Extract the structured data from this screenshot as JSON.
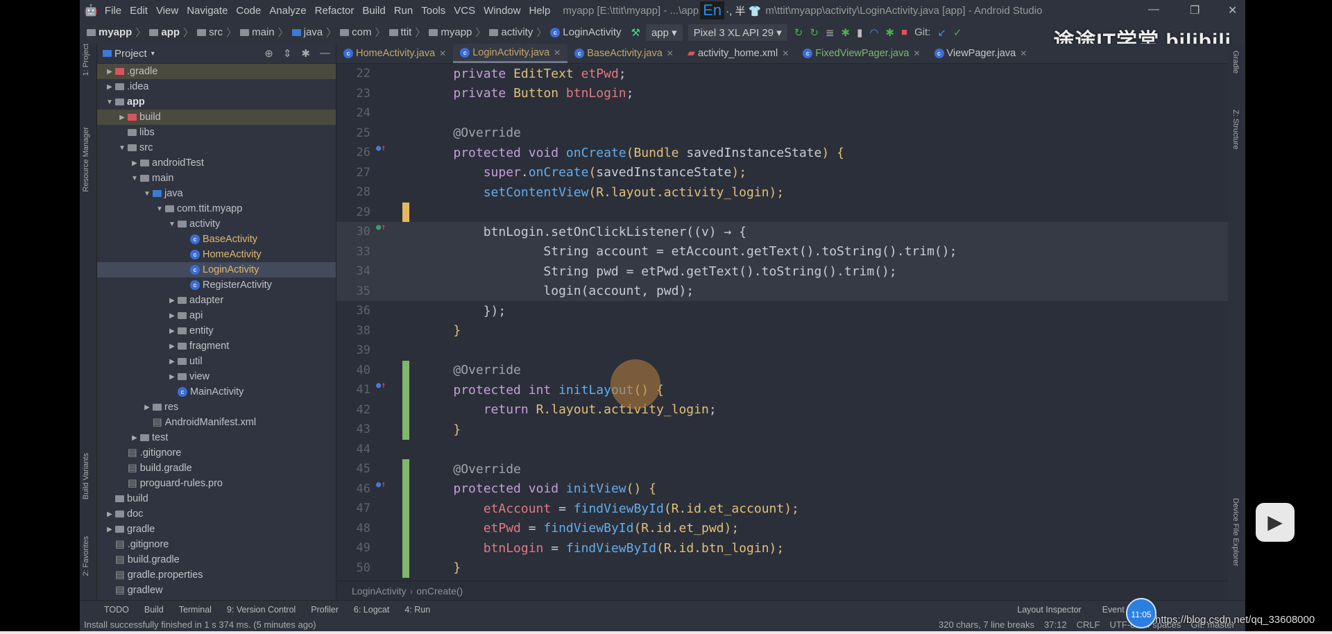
{
  "window": {
    "title": "myapp [E:\\ttit\\myapp] - ...\\app",
    "title_rest": "m\\ttit\\myapp\\activity\\LoginActivity.java [app] - Android Studio",
    "ime": "En",
    "ime_extra": "·, 半 👕",
    "minimize": "—",
    "restore": "❐",
    "close": "✕"
  },
  "menu": [
    "File",
    "Edit",
    "View",
    "Navigate",
    "Code",
    "Analyze",
    "Refactor",
    "Build",
    "Run",
    "Tools",
    "VCS",
    "Window",
    "Help"
  ],
  "breadcrumb": [
    {
      "label": "myapp",
      "bold": true,
      "icon": "module-folder"
    },
    {
      "label": "app",
      "bold": true,
      "icon": "module-folder"
    },
    {
      "label": "src",
      "icon": "folder"
    },
    {
      "label": "main",
      "icon": "folder"
    },
    {
      "label": "java",
      "icon": "source-folder"
    },
    {
      "label": "com",
      "icon": "package"
    },
    {
      "label": "ttit",
      "icon": "package"
    },
    {
      "label": "myapp",
      "icon": "package"
    },
    {
      "label": "activity",
      "icon": "package"
    },
    {
      "label": "LoginActivity",
      "icon": "class"
    }
  ],
  "toolbar": {
    "run_config": "app",
    "device": "Pixel 3 XL API 29",
    "git_label": "Git:"
  },
  "watermark": "途途IT学堂 bilibili",
  "left_strip": {
    "project": "1: Project",
    "resource_manager": "Resource Manager",
    "build_variants": "Build Variants",
    "favorites": "2: Favorites"
  },
  "right_strip": {
    "gradle": "Gradle",
    "structure": "Z: Structure",
    "device_explorer": "Device File Explorer"
  },
  "project_panel": {
    "title": "Project",
    "items": [
      {
        "label": ".gradle",
        "depth": 0,
        "arrow": "right",
        "icon": "red",
        "hl": true
      },
      {
        "label": ".idea",
        "depth": 0,
        "arrow": "right",
        "icon": "folder"
      },
      {
        "label": "app",
        "depth": 0,
        "arrow": "down",
        "icon": "folder",
        "bold": true
      },
      {
        "label": "build",
        "depth": 1,
        "arrow": "right",
        "icon": "red",
        "hl": true
      },
      {
        "label": "libs",
        "depth": 1,
        "arrow": "",
        "icon": "folder"
      },
      {
        "label": "src",
        "depth": 1,
        "arrow": "down",
        "icon": "folder"
      },
      {
        "label": "androidTest",
        "depth": 2,
        "arrow": "right",
        "icon": "folder"
      },
      {
        "label": "main",
        "depth": 2,
        "arrow": "down",
        "icon": "folder"
      },
      {
        "label": "java",
        "depth": 3,
        "arrow": "down",
        "icon": "blue"
      },
      {
        "label": "com.ttit.myapp",
        "depth": 4,
        "arrow": "down",
        "icon": "folder"
      },
      {
        "label": "activity",
        "depth": 5,
        "arrow": "down",
        "icon": "folder"
      },
      {
        "label": "BaseActivity",
        "depth": 6,
        "arrow": "",
        "icon": "class",
        "java": true
      },
      {
        "label": "HomeActivity",
        "depth": 6,
        "arrow": "",
        "icon": "class",
        "java": true
      },
      {
        "label": "LoginActivity",
        "depth": 6,
        "arrow": "",
        "icon": "class",
        "java": true,
        "sel": true
      },
      {
        "label": "RegisterActivity",
        "depth": 6,
        "arrow": "",
        "icon": "class"
      },
      {
        "label": "adapter",
        "depth": 5,
        "arrow": "right",
        "icon": "folder"
      },
      {
        "label": "api",
        "depth": 5,
        "arrow": "right",
        "icon": "folder"
      },
      {
        "label": "entity",
        "depth": 5,
        "arrow": "right",
        "icon": "folder"
      },
      {
        "label": "fragment",
        "depth": 5,
        "arrow": "right",
        "icon": "folder"
      },
      {
        "label": "util",
        "depth": 5,
        "arrow": "right",
        "icon": "folder"
      },
      {
        "label": "view",
        "depth": 5,
        "arrow": "right",
        "icon": "folder"
      },
      {
        "label": "MainActivity",
        "depth": 5,
        "arrow": "",
        "icon": "class"
      },
      {
        "label": "res",
        "depth": 3,
        "arrow": "right",
        "icon": "folder"
      },
      {
        "label": "AndroidManifest.xml",
        "depth": 3,
        "arrow": "",
        "icon": "file"
      },
      {
        "label": "test",
        "depth": 2,
        "arrow": "right",
        "icon": "folder"
      },
      {
        "label": ".gitignore",
        "depth": 1,
        "arrow": "",
        "icon": "file"
      },
      {
        "label": "build.gradle",
        "depth": 1,
        "arrow": "",
        "icon": "file"
      },
      {
        "label": "proguard-rules.pro",
        "depth": 1,
        "arrow": "",
        "icon": "file"
      },
      {
        "label": "build",
        "depth": 0,
        "arrow": "",
        "icon": "folder"
      },
      {
        "label": "doc",
        "depth": 0,
        "arrow": "right",
        "icon": "folder"
      },
      {
        "label": "gradle",
        "depth": 0,
        "arrow": "right",
        "icon": "folder"
      },
      {
        "label": ".gitignore",
        "depth": 0,
        "arrow": "",
        "icon": "file"
      },
      {
        "label": "build.gradle",
        "depth": 0,
        "arrow": "",
        "icon": "file"
      },
      {
        "label": "gradle.properties",
        "depth": 0,
        "arrow": "",
        "icon": "file"
      },
      {
        "label": "gradlew",
        "depth": 0,
        "arrow": "",
        "icon": "file"
      }
    ]
  },
  "tabs": [
    {
      "label": "HomeActivity.java",
      "style": "java"
    },
    {
      "label": "LoginActivity.java",
      "style": "java",
      "active": true
    },
    {
      "label": "BaseActivity.java",
      "style": "java"
    },
    {
      "label": "activity_home.xml",
      "style": "xml"
    },
    {
      "label": "FixedViewPager.java",
      "style": "green"
    },
    {
      "label": "ViewPager.java",
      "style": "plain"
    }
  ],
  "code": [
    {
      "n": "22",
      "t": [
        [
          "    ",
          "s"
        ],
        [
          "private ",
          "k"
        ],
        [
          "EditText ",
          "t"
        ],
        [
          "etPwd",
          "f"
        ],
        [
          ";",
          "s"
        ]
      ]
    },
    {
      "n": "23",
      "t": [
        [
          "    ",
          "s"
        ],
        [
          "private ",
          "k"
        ],
        [
          "Button ",
          "t"
        ],
        [
          "btnLogin",
          "f"
        ],
        [
          ";",
          "s"
        ]
      ]
    },
    {
      "n": "24",
      "t": []
    },
    {
      "n": "25",
      "t": [
        [
          "    ",
          "s"
        ],
        [
          "@Override",
          "a"
        ]
      ]
    },
    {
      "n": "26",
      "mark": "o",
      "t": [
        [
          "    ",
          "s"
        ],
        [
          "protected ",
          "k"
        ],
        [
          "void ",
          "k"
        ],
        [
          "onCreate",
          "m"
        ],
        [
          "(",
          "p"
        ],
        [
          "Bundle ",
          "t"
        ],
        [
          "savedInstanceState",
          "s"
        ],
        [
          ") {",
          "p"
        ]
      ]
    },
    {
      "n": "27",
      "t": [
        [
          "        ",
          "s"
        ],
        [
          "super",
          "k"
        ],
        [
          ".",
          "s"
        ],
        [
          "onCreate",
          "m"
        ],
        [
          "(",
          "p"
        ],
        [
          "savedInstanceState",
          "s"
        ],
        [
          ");",
          "p"
        ]
      ]
    },
    {
      "n": "28",
      "t": [
        [
          "        ",
          "s"
        ],
        [
          "setContentView",
          "m"
        ],
        [
          "(",
          "p"
        ],
        [
          "R.layout.activity_login",
          "t"
        ],
        [
          ");",
          "p"
        ]
      ]
    },
    {
      "n": "29",
      "change": "#e5b860",
      "t": []
    },
    {
      "n": "30",
      "mark": "I",
      "lam": true,
      "t": [
        [
          "        btnLogin.setOnClickListener((v) → {",
          "s"
        ]
      ]
    },
    {
      "n": "33",
      "lam": true,
      "t": [
        [
          "                String account = etAccount.getText().toString().trim();",
          "s"
        ]
      ]
    },
    {
      "n": "34",
      "lam": true,
      "t": [
        [
          "                String pwd = etPwd.getText().toString().trim();",
          "s"
        ]
      ]
    },
    {
      "n": "35",
      "lam": true,
      "t": [
        [
          "                login(account, pwd);",
          "s"
        ]
      ]
    },
    {
      "n": "36",
      "t": [
        [
          "        });",
          "s"
        ]
      ]
    },
    {
      "n": "38",
      "t": [
        [
          "    }",
          "p"
        ]
      ]
    },
    {
      "n": "39",
      "t": []
    },
    {
      "n": "40",
      "change": "#7fb86a",
      "t": [
        [
          "    ",
          "s"
        ],
        [
          "@Override",
          "a"
        ]
      ]
    },
    {
      "n": "41",
      "mark": "o",
      "change": "#7fb86a",
      "t": [
        [
          "    ",
          "s"
        ],
        [
          "protected ",
          "k"
        ],
        [
          "int ",
          "k"
        ],
        [
          "initLayout",
          "m"
        ],
        [
          "() {",
          "p"
        ]
      ]
    },
    {
      "n": "42",
      "change": "#7fb86a",
      "t": [
        [
          "        ",
          "s"
        ],
        [
          "return ",
          "k"
        ],
        [
          "R.layout.activity_login",
          "t"
        ],
        [
          ";",
          "s"
        ]
      ]
    },
    {
      "n": "43",
      "change": "#7fb86a",
      "t": [
        [
          "    }",
          "p"
        ]
      ]
    },
    {
      "n": "44",
      "t": []
    },
    {
      "n": "45",
      "change": "#7fb86a",
      "t": [
        [
          "    ",
          "s"
        ],
        [
          "@Override",
          "a"
        ]
      ]
    },
    {
      "n": "46",
      "mark": "o",
      "change": "#7fb86a",
      "t": [
        [
          "    ",
          "s"
        ],
        [
          "protected ",
          "k"
        ],
        [
          "void ",
          "k"
        ],
        [
          "initView",
          "m"
        ],
        [
          "() {",
          "p"
        ]
      ]
    },
    {
      "n": "47",
      "change": "#7fb86a",
      "t": [
        [
          "        ",
          "s"
        ],
        [
          "etAccount",
          "f"
        ],
        [
          " = ",
          "s"
        ],
        [
          "findViewById",
          "m"
        ],
        [
          "(",
          "p"
        ],
        [
          "R.id.et_account",
          "t"
        ],
        [
          ");",
          "p"
        ]
      ]
    },
    {
      "n": "48",
      "change": "#7fb86a",
      "t": [
        [
          "        ",
          "s"
        ],
        [
          "etPwd",
          "f"
        ],
        [
          " = ",
          "s"
        ],
        [
          "findViewById",
          "m"
        ],
        [
          "(",
          "p"
        ],
        [
          "R.id.et_pwd",
          "t"
        ],
        [
          ");",
          "p"
        ]
      ]
    },
    {
      "n": "49",
      "change": "#7fb86a",
      "t": [
        [
          "        ",
          "s"
        ],
        [
          "btnLogin",
          "f"
        ],
        [
          " = ",
          "s"
        ],
        [
          "findViewById",
          "m"
        ],
        [
          "(",
          "p"
        ],
        [
          "R.id.btn_login",
          "t"
        ],
        [
          ");",
          "p"
        ]
      ]
    },
    {
      "n": "50",
      "change": "#7fb86a",
      "t": [
        [
          "    }",
          "p"
        ]
      ]
    }
  ],
  "editor_breadcrumb": [
    "LoginActivity",
    "onCreate()"
  ],
  "bottom_tools": [
    "TODO",
    "Build",
    "Terminal",
    "9: Version Control",
    "Profiler",
    "6: Logcat",
    "4: Run"
  ],
  "bottom_right": [
    "Layout Inspector",
    "Event Log"
  ],
  "status": {
    "message": "Install successfully finished in 1 s 374 ms. (5 minutes ago)",
    "chars": "320 chars, 7 line breaks",
    "position": "37:12",
    "line_sep": "CRLF",
    "encoding": "UTF-8",
    "indent": "4 spaces",
    "vcs": "Git: master"
  },
  "overlay": {
    "clock": "11:05",
    "url": "https://blog.csdn.net/qq_33608000"
  }
}
